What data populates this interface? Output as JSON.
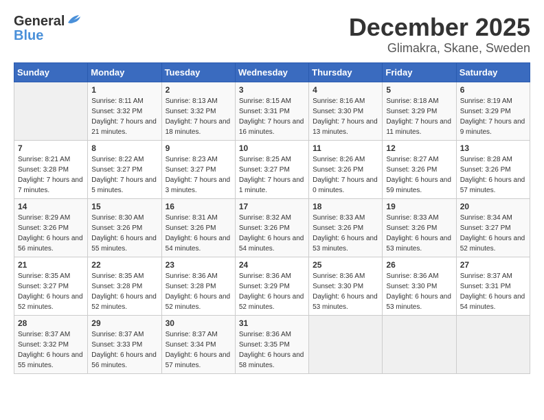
{
  "header": {
    "logo_general": "General",
    "logo_blue": "Blue",
    "month_title": "December 2025",
    "location": "Glimakra, Skane, Sweden"
  },
  "weekdays": [
    "Sunday",
    "Monday",
    "Tuesday",
    "Wednesday",
    "Thursday",
    "Friday",
    "Saturday"
  ],
  "weeks": [
    [
      {
        "day": "",
        "sunrise": "",
        "sunset": "",
        "daylight": ""
      },
      {
        "day": "1",
        "sunrise": "Sunrise: 8:11 AM",
        "sunset": "Sunset: 3:32 PM",
        "daylight": "Daylight: 7 hours and 21 minutes."
      },
      {
        "day": "2",
        "sunrise": "Sunrise: 8:13 AM",
        "sunset": "Sunset: 3:32 PM",
        "daylight": "Daylight: 7 hours and 18 minutes."
      },
      {
        "day": "3",
        "sunrise": "Sunrise: 8:15 AM",
        "sunset": "Sunset: 3:31 PM",
        "daylight": "Daylight: 7 hours and 16 minutes."
      },
      {
        "day": "4",
        "sunrise": "Sunrise: 8:16 AM",
        "sunset": "Sunset: 3:30 PM",
        "daylight": "Daylight: 7 hours and 13 minutes."
      },
      {
        "day": "5",
        "sunrise": "Sunrise: 8:18 AM",
        "sunset": "Sunset: 3:29 PM",
        "daylight": "Daylight: 7 hours and 11 minutes."
      },
      {
        "day": "6",
        "sunrise": "Sunrise: 8:19 AM",
        "sunset": "Sunset: 3:29 PM",
        "daylight": "Daylight: 7 hours and 9 minutes."
      }
    ],
    [
      {
        "day": "7",
        "sunrise": "Sunrise: 8:21 AM",
        "sunset": "Sunset: 3:28 PM",
        "daylight": "Daylight: 7 hours and 7 minutes."
      },
      {
        "day": "8",
        "sunrise": "Sunrise: 8:22 AM",
        "sunset": "Sunset: 3:27 PM",
        "daylight": "Daylight: 7 hours and 5 minutes."
      },
      {
        "day": "9",
        "sunrise": "Sunrise: 8:23 AM",
        "sunset": "Sunset: 3:27 PM",
        "daylight": "Daylight: 7 hours and 3 minutes."
      },
      {
        "day": "10",
        "sunrise": "Sunrise: 8:25 AM",
        "sunset": "Sunset: 3:27 PM",
        "daylight": "Daylight: 7 hours and 1 minute."
      },
      {
        "day": "11",
        "sunrise": "Sunrise: 8:26 AM",
        "sunset": "Sunset: 3:26 PM",
        "daylight": "Daylight: 7 hours and 0 minutes."
      },
      {
        "day": "12",
        "sunrise": "Sunrise: 8:27 AM",
        "sunset": "Sunset: 3:26 PM",
        "daylight": "Daylight: 6 hours and 59 minutes."
      },
      {
        "day": "13",
        "sunrise": "Sunrise: 8:28 AM",
        "sunset": "Sunset: 3:26 PM",
        "daylight": "Daylight: 6 hours and 57 minutes."
      }
    ],
    [
      {
        "day": "14",
        "sunrise": "Sunrise: 8:29 AM",
        "sunset": "Sunset: 3:26 PM",
        "daylight": "Daylight: 6 hours and 56 minutes."
      },
      {
        "day": "15",
        "sunrise": "Sunrise: 8:30 AM",
        "sunset": "Sunset: 3:26 PM",
        "daylight": "Daylight: 6 hours and 55 minutes."
      },
      {
        "day": "16",
        "sunrise": "Sunrise: 8:31 AM",
        "sunset": "Sunset: 3:26 PM",
        "daylight": "Daylight: 6 hours and 54 minutes."
      },
      {
        "day": "17",
        "sunrise": "Sunrise: 8:32 AM",
        "sunset": "Sunset: 3:26 PM",
        "daylight": "Daylight: 6 hours and 54 minutes."
      },
      {
        "day": "18",
        "sunrise": "Sunrise: 8:33 AM",
        "sunset": "Sunset: 3:26 PM",
        "daylight": "Daylight: 6 hours and 53 minutes."
      },
      {
        "day": "19",
        "sunrise": "Sunrise: 8:33 AM",
        "sunset": "Sunset: 3:26 PM",
        "daylight": "Daylight: 6 hours and 53 minutes."
      },
      {
        "day": "20",
        "sunrise": "Sunrise: 8:34 AM",
        "sunset": "Sunset: 3:27 PM",
        "daylight": "Daylight: 6 hours and 52 minutes."
      }
    ],
    [
      {
        "day": "21",
        "sunrise": "Sunrise: 8:35 AM",
        "sunset": "Sunset: 3:27 PM",
        "daylight": "Daylight: 6 hours and 52 minutes."
      },
      {
        "day": "22",
        "sunrise": "Sunrise: 8:35 AM",
        "sunset": "Sunset: 3:28 PM",
        "daylight": "Daylight: 6 hours and 52 minutes."
      },
      {
        "day": "23",
        "sunrise": "Sunrise: 8:36 AM",
        "sunset": "Sunset: 3:28 PM",
        "daylight": "Daylight: 6 hours and 52 minutes."
      },
      {
        "day": "24",
        "sunrise": "Sunrise: 8:36 AM",
        "sunset": "Sunset: 3:29 PM",
        "daylight": "Daylight: 6 hours and 52 minutes."
      },
      {
        "day": "25",
        "sunrise": "Sunrise: 8:36 AM",
        "sunset": "Sunset: 3:30 PM",
        "daylight": "Daylight: 6 hours and 53 minutes."
      },
      {
        "day": "26",
        "sunrise": "Sunrise: 8:36 AM",
        "sunset": "Sunset: 3:30 PM",
        "daylight": "Daylight: 6 hours and 53 minutes."
      },
      {
        "day": "27",
        "sunrise": "Sunrise: 8:37 AM",
        "sunset": "Sunset: 3:31 PM",
        "daylight": "Daylight: 6 hours and 54 minutes."
      }
    ],
    [
      {
        "day": "28",
        "sunrise": "Sunrise: 8:37 AM",
        "sunset": "Sunset: 3:32 PM",
        "daylight": "Daylight: 6 hours and 55 minutes."
      },
      {
        "day": "29",
        "sunrise": "Sunrise: 8:37 AM",
        "sunset": "Sunset: 3:33 PM",
        "daylight": "Daylight: 6 hours and 56 minutes."
      },
      {
        "day": "30",
        "sunrise": "Sunrise: 8:37 AM",
        "sunset": "Sunset: 3:34 PM",
        "daylight": "Daylight: 6 hours and 57 minutes."
      },
      {
        "day": "31",
        "sunrise": "Sunrise: 8:36 AM",
        "sunset": "Sunset: 3:35 PM",
        "daylight": "Daylight: 6 hours and 58 minutes."
      },
      {
        "day": "",
        "sunrise": "",
        "sunset": "",
        "daylight": ""
      },
      {
        "day": "",
        "sunrise": "",
        "sunset": "",
        "daylight": ""
      },
      {
        "day": "",
        "sunrise": "",
        "sunset": "",
        "daylight": ""
      }
    ]
  ]
}
